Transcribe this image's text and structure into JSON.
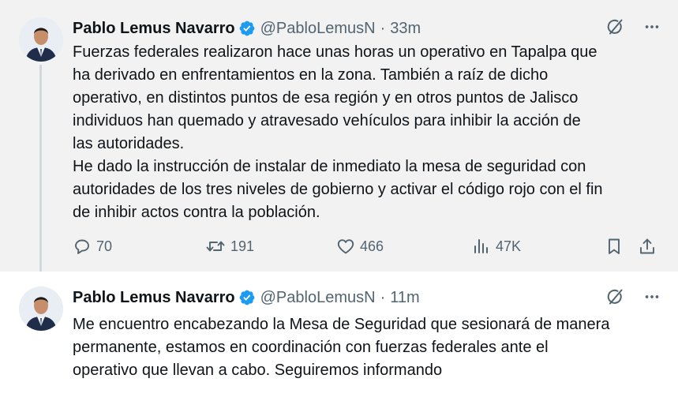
{
  "tweets": [
    {
      "author_name": "Pablo Lemus Navarro",
      "handle": "@PabloLemusN",
      "separator": "·",
      "time": "33m",
      "verified": true,
      "text_lines": [
        "Fuerzas federales realizaron hace unas horas un operativo en Tapalpa que",
        "ha derivado en enfrentamientos en la zona. También a raíz de dicho",
        "operativo, en distintos puntos de esa región y en otros puntos de Jalisco",
        "individuos han quemado y atravesado vehículos para inhibir la acción de",
        "las autoridades.",
        "He dado la instrucción de instalar de inmediato la mesa de seguridad con",
        "autoridades de los tres niveles de gobierno y activar el código rojo con el fin",
        "de inhibir actos contra la población."
      ],
      "replies": "70",
      "retweets": "191",
      "likes": "466",
      "views": "47K"
    },
    {
      "author_name": "Pablo Lemus Navarro",
      "handle": "@PabloLemusN",
      "separator": "·",
      "time": "11m",
      "verified": true,
      "text_lines": [
        "Me encuentro encabezando la Mesa de Seguridad que sesionará de manera",
        "permanente, estamos en coordinación con fuerzas federales ante el",
        "operativo que llevan a cabo. Seguiremos informando"
      ]
    }
  ],
  "icons": {
    "verified": "verified-badge-icon",
    "grok": "grok-icon",
    "more": "more-icon",
    "reply": "reply-icon",
    "retweet": "retweet-icon",
    "like": "heart-icon",
    "views": "views-icon",
    "bookmark": "bookmark-icon",
    "share": "share-icon"
  },
  "colors": {
    "verified": "#1d9bf0",
    "text_primary": "#0f1419",
    "text_secondary": "#536471",
    "highlight_background": "#f2f2f2"
  }
}
